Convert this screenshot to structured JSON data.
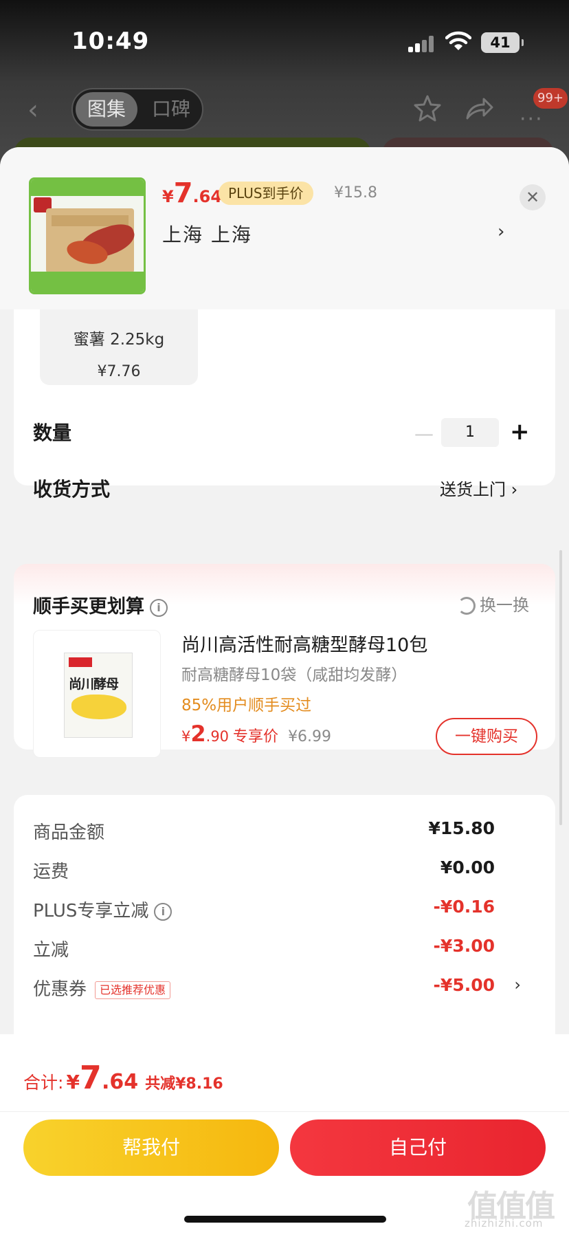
{
  "status_bar": {
    "time": "10:49",
    "battery": "41"
  },
  "nav": {
    "tabs": [
      "图集",
      "口碑"
    ],
    "active_tab": 0,
    "message_badge": "99+"
  },
  "product": {
    "price_yen": "¥",
    "price_int": "7",
    "price_dec": ".64",
    "plus_tag": "PLUS到手价",
    "original_price": "¥15.8",
    "address": "上海  上海"
  },
  "spec": {
    "name": "蜜薯 2.25kg",
    "price": "¥7.76"
  },
  "quantity": {
    "label": "数量",
    "value": "1"
  },
  "delivery": {
    "label": "收货方式",
    "value": "送货上门"
  },
  "bundle": {
    "title": "顺手买更划算",
    "swap_label": "换一换",
    "name": "尚川高活性耐高糖型酵母10包",
    "subtitle": "耐高糖酵母10袋（咸甜均发酵）",
    "rate": "85%用户顺手买过",
    "price_yen": "¥",
    "price_int": "2",
    "price_dec": ".90",
    "price_tag": "专享价",
    "original_price": "¥6.99",
    "buy_label": "一键购买",
    "pack_title": "尚川酵母"
  },
  "summary": {
    "rows": [
      {
        "label": "商品金额",
        "value": "¥15.80"
      },
      {
        "label": "运费",
        "value": "¥0.00"
      },
      {
        "label": "PLUS专享立减",
        "value": "-¥0.16"
      },
      {
        "label": "立减",
        "value": "-¥3.00"
      },
      {
        "label": "优惠券",
        "value": "-¥5.00",
        "tag": "已选推荐优惠"
      }
    ]
  },
  "footer": {
    "total_label": "合计:",
    "total_yen": "¥",
    "total_int": "7",
    "total_dec": ".64",
    "saved": "共减¥8.16",
    "help_pay": "帮我付",
    "self_pay": "自己付"
  },
  "watermark": {
    "text": "值值值",
    "sub": "zhizhizhi.com"
  },
  "colors": {
    "accent_red": "#e4322b",
    "plus_gold": "#fbe3a6",
    "help_yellow": "#f8d22c",
    "rate_orange": "#e38c1f"
  }
}
